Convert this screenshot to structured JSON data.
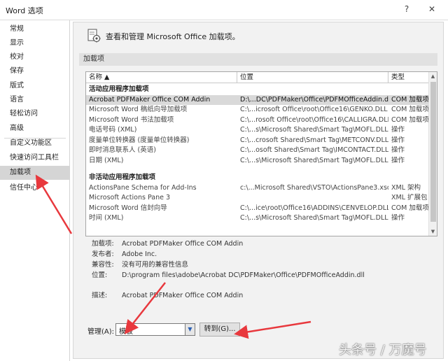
{
  "window": {
    "title": "Word 选项",
    "help_glyph": "?",
    "close_glyph": "✕"
  },
  "sidebar": {
    "items": [
      {
        "label": "常规"
      },
      {
        "label": "显示"
      },
      {
        "label": "校对"
      },
      {
        "label": "保存"
      },
      {
        "label": "版式"
      },
      {
        "label": "语言"
      },
      {
        "label": "轻松访问"
      },
      {
        "label": "高级"
      },
      {
        "label": "自定义功能区"
      },
      {
        "label": "快速访问工具栏"
      },
      {
        "label": "加载项"
      },
      {
        "label": "信任中心"
      }
    ],
    "active": "加载项"
  },
  "header": {
    "text": "查看和管理 Microsoft Office 加载项。",
    "icon": "addins-gear-icon"
  },
  "section": {
    "title": "加载项"
  },
  "table": {
    "columns": [
      "名称 ▲",
      "位置",
      "类型"
    ],
    "groups": [
      {
        "title": "活动应用程序加载项",
        "rows": [
          {
            "name": "Acrobat PDFMaker Office COM Addin",
            "location": "D:\\...DC\\PDFMaker\\Office\\PDFMOfficeAddin.dll",
            "type": "COM 加载项",
            "selected": true
          },
          {
            "name": "Microsoft Word 稿纸向导加载项",
            "location": "C:\\...icrosoft Office\\root\\Office16\\GENKO.DLL",
            "type": "COM 加载项"
          },
          {
            "name": "Microsoft Word 书法加载项",
            "location": "C:\\...rosoft Office\\root\\Office16\\CALLIGRA.DLL",
            "type": "COM 加载项"
          },
          {
            "name": "电话号码 (XML)",
            "location": "C:\\...s\\Microsoft Shared\\Smart Tag\\MOFL.DLL",
            "type": "操作"
          },
          {
            "name": "度量单位转换器 (度量单位转换器)",
            "location": "C:\\...crosoft Shared\\Smart Tag\\METCONV.DLL",
            "type": "操作"
          },
          {
            "name": "即时消息联系人 (英语)",
            "location": "C:\\...osoft Shared\\Smart Tag\\IMCONTACT.DLL",
            "type": "操作"
          },
          {
            "name": "日期 (XML)",
            "location": "C:\\...s\\Microsoft Shared\\Smart Tag\\MOFL.DLL",
            "type": "操作"
          }
        ]
      },
      {
        "title": "非活动应用程序加载项",
        "rows": [
          {
            "name": "ActionsPane Schema for Add-Ins",
            "location": "c:\\...Microsoft Shared\\VSTO\\ActionsPane3.xsd",
            "type": "XML 架构"
          },
          {
            "name": "Microsoft Actions Pane 3",
            "location": "",
            "type": "XML 扩展包"
          },
          {
            "name": "Microsoft Word 信封向导",
            "location": "C:\\...ice\\root\\Office16\\ADDINS\\CENVELOP.DLL",
            "type": "COM 加载项"
          },
          {
            "name": "时间 (XML)",
            "location": "C:\\...s\\Microsoft Shared\\Smart Tag\\MOFL.DLL",
            "type": "操作"
          }
        ]
      }
    ]
  },
  "details": {
    "addin_label": "加载项:",
    "addin_value": "Acrobat PDFMaker Office COM Addin",
    "publisher_label": "发布者:",
    "publisher_value": "Adobe Inc.",
    "compat_label": "兼容性:",
    "compat_value": "没有可用的兼容性信息",
    "location_label": "位置:",
    "location_value": "D:\\program files\\adobe\\Acrobat DC\\PDFMaker\\Office\\PDFMOfficeAddin.dll",
    "desc_label": "描述:",
    "desc_value": "Acrobat PDFMaker Office COM Addin"
  },
  "manage": {
    "label": "管理(A):",
    "selected": "模板",
    "goto_label": "转到(G)..."
  },
  "watermark": {
    "text": "头条号 / 万魔号"
  },
  "colors": {
    "sidebar_active": "#d5d5d5",
    "annotation_arrow": "#e8383d",
    "content_bg": "#f2f2f2"
  }
}
